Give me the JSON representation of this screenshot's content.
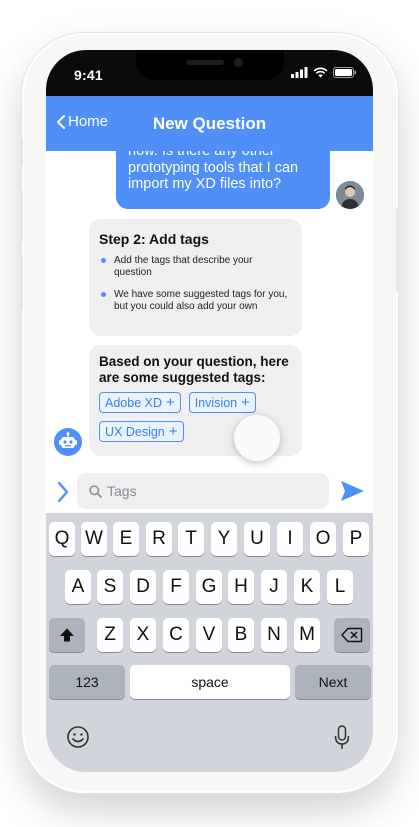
{
  "status_bar": {
    "time": "9:41"
  },
  "nav": {
    "back_label": "Home",
    "title": "New Question"
  },
  "chat": {
    "user_message_lines": [
      "now. Is there any other",
      "prototyping tools that I can",
      "import my XD files into?"
    ],
    "step_card": {
      "title": "Step 2: Add tags",
      "bullets": [
        "Add the tags that describe your question",
        "We have some suggested tags for you, but you could also add your own"
      ]
    },
    "tags_card": {
      "title": "Based on your question, here are some suggested tags:",
      "tags": [
        "Adobe XD",
        "Invision",
        "UX Design"
      ]
    }
  },
  "input_bar": {
    "placeholder": "Tags",
    "value": ""
  },
  "keyboard": {
    "row1": [
      "Q",
      "W",
      "E",
      "R",
      "T",
      "Y",
      "U",
      "I",
      "O",
      "P"
    ],
    "row2": [
      "A",
      "S",
      "D",
      "F",
      "G",
      "H",
      "J",
      "K",
      "L"
    ],
    "row3": [
      "Z",
      "X",
      "C",
      "V",
      "B",
      "N",
      "M"
    ],
    "numbers_key": "123",
    "space_key": "space",
    "next_key": "Next"
  },
  "colors": {
    "accent": "#4f8ff7",
    "keyboard_bg": "#d1d4da",
    "card_bg": "#efeff1"
  },
  "icons": [
    "back-chevron-icon",
    "signal-icon",
    "wifi-icon",
    "battery-icon",
    "robot-icon",
    "plus-icon",
    "search-icon",
    "chevron-right-icon",
    "send-icon",
    "shift-icon",
    "backspace-icon",
    "emoji-icon",
    "microphone-icon"
  ]
}
